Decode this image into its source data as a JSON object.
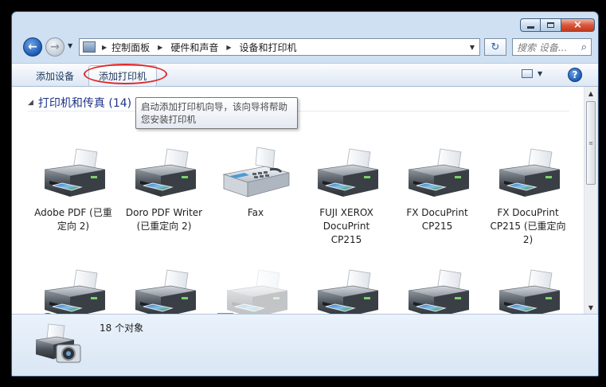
{
  "window": {
    "caption": {
      "minimize": "minimize",
      "maximize": "maximize",
      "close": "×"
    }
  },
  "nav": {
    "back_glyph": "←",
    "forward_glyph": "→",
    "history_glyph": "▼",
    "breadcrumb": [
      "控制面板",
      "硬件和声音",
      "设备和打印机"
    ],
    "refresh_glyph": "↻",
    "search_placeholder": "搜索 设备...",
    "search_glyph": "⌕"
  },
  "commandbar": {
    "add_device": "添加设备",
    "add_printer": "添加打印机",
    "help_glyph": "?"
  },
  "group": {
    "toggle": "◢",
    "title": "打印机和传真 (14)"
  },
  "tooltip": {
    "text": "启动添加打印机向导，该向导将帮助您安装打印机"
  },
  "items_row1": [
    {
      "label": "Adobe PDF (已重定向 2)",
      "type": "printer"
    },
    {
      "label": "Doro PDF Writer (已重定向 2)",
      "type": "printer"
    },
    {
      "label": "Fax",
      "type": "fax"
    },
    {
      "label": "FUJI XEROX DocuPrint CP215",
      "type": "printer"
    },
    {
      "label": "FX DocuPrint CP215",
      "type": "printer"
    },
    {
      "label": "FX DocuPrint CP215 (已重定向 2)",
      "type": "printer"
    }
  ],
  "items_row2": [
    {
      "badge": "✔"
    },
    {
      "badge": ""
    },
    {
      "badge": "👥"
    },
    {
      "badge": ""
    },
    {
      "badge": ""
    },
    {
      "badge": ""
    }
  ],
  "scrollbar": {
    "up": "▲",
    "down": "▼",
    "grip": "≡"
  },
  "details": {
    "count": "18 个对象"
  },
  "colors": {
    "highlight_ring": "#e0292b",
    "group_title": "#1e3287"
  }
}
